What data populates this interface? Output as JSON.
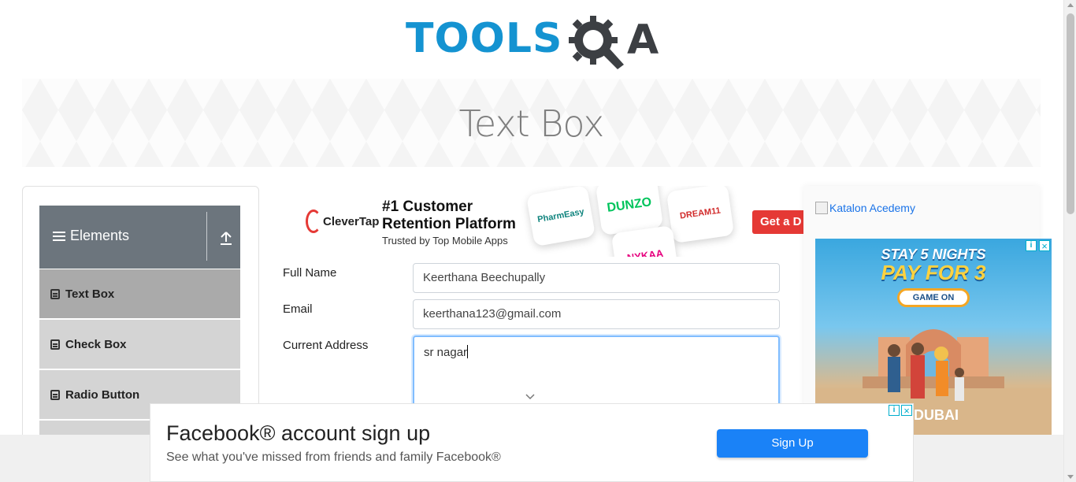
{
  "header": {
    "logo_tools": "TOOLS",
    "logo_qa": "A"
  },
  "banner": {
    "title": "Text Box"
  },
  "sidebar": {
    "group_title": "Elements",
    "items": [
      {
        "label": "Text Box",
        "active": true
      },
      {
        "label": "Check Box",
        "active": false
      },
      {
        "label": "Radio Button",
        "active": false
      }
    ]
  },
  "ad_top": {
    "brand": "CleverTap",
    "headline_1": "#1 Customer",
    "headline_2": "Retention Platform",
    "subline": "Trusted by Top Mobile Apps",
    "partners": [
      "PharmEasy",
      "DUNZO",
      "DREAM11",
      "NYKAA"
    ],
    "cta": "Get a D"
  },
  "form": {
    "full_name_label": "Full Name",
    "full_name_value": "Keerthana Beechupally",
    "email_label": "Email",
    "email_value": "keerthana123@gmail.com",
    "address_label": "Current Address",
    "address_value": "sr nagar"
  },
  "right_ad": {
    "katalon_alt": "Katalon Acedemy",
    "title_1": "STAY 5 NIGHTS",
    "title_2": "PAY FOR 3",
    "button": "GAME ON",
    "brand": "DUBAI"
  },
  "fb_ad": {
    "title": "Facebook® account sign up",
    "subtitle": "See what you've missed from friends and family Facebook®",
    "button": "Sign Up"
  },
  "colors": {
    "tools_blue": "#1493d1",
    "sidebar_header": "#6c757d",
    "fb_button": "#1a82f7",
    "ad_cta": "#e53935"
  }
}
